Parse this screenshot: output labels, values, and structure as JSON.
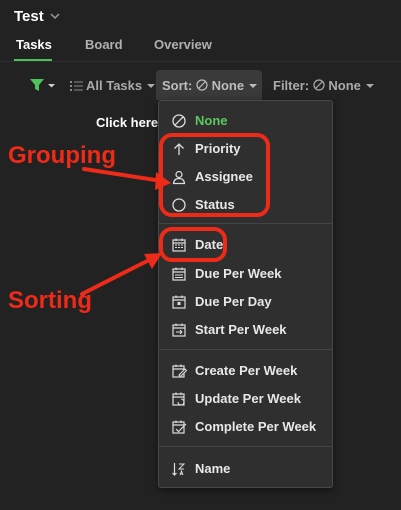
{
  "header": {
    "project_title": "Test"
  },
  "tabs": [
    {
      "label": "Tasks",
      "active": true
    },
    {
      "label": "Board"
    },
    {
      "label": "Overview"
    }
  ],
  "toolbar": {
    "view_label": "All Tasks",
    "sort_label": "Sort:",
    "sort_value": "None",
    "filter_label": "Filter:",
    "filter_value": "None",
    "hint_text": "Click here"
  },
  "sort_menu": {
    "none": "None",
    "priority": "Priority",
    "assignee": "Assignee",
    "status": "Status",
    "date": "Date",
    "due_per_week": "Due Per Week",
    "due_per_day": "Due Per Day",
    "start_per_week": "Start Per Week",
    "create_per_week": "Create Per Week",
    "update_per_week": "Update Per Week",
    "complete_per_week": "Complete Per Week",
    "name": "Name"
  },
  "annotations": {
    "grouping": "Grouping",
    "sorting": "Sorting"
  },
  "colors": {
    "accent": "#4ec25a",
    "annotation": "#ee2a18"
  }
}
